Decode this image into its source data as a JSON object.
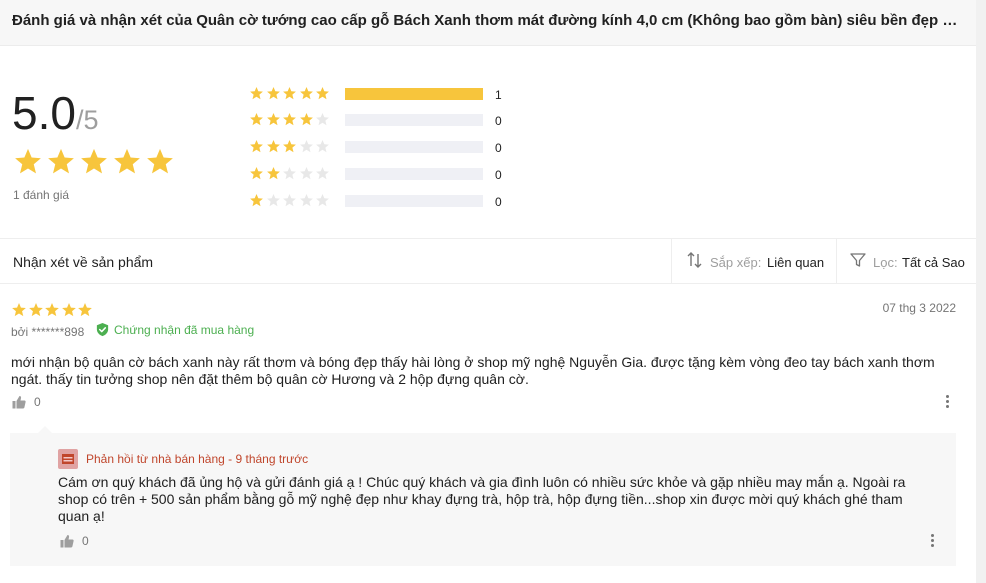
{
  "header": {
    "title": "Đánh giá và nhận xét của Quân cờ tướng cao cấp gỗ Bách Xanh thơm mát đường kính 4,0 cm (Không bao gồm bàn) siêu bền đẹp b..."
  },
  "summary": {
    "score": "5.0",
    "score_max": "/5",
    "star_count": 5,
    "total_label": "1 đánh giá",
    "distribution": [
      {
        "stars": 5,
        "count": "1",
        "fraction": 1.0
      },
      {
        "stars": 4,
        "count": "0",
        "fraction": 0
      },
      {
        "stars": 3,
        "count": "0",
        "fraction": 0
      },
      {
        "stars": 2,
        "count": "0",
        "fraction": 0
      },
      {
        "stars": 1,
        "count": "0",
        "fraction": 0
      }
    ]
  },
  "toolbar": {
    "title": "Nhận xét về sản phẩm",
    "sort_label": "Sắp xếp:",
    "sort_value": "Liên quan",
    "filter_label": "Lọc:",
    "filter_value": "Tất cả Sao"
  },
  "review": {
    "rating": 5,
    "date": "07 thg 3 2022",
    "author": "bởi *******898",
    "verified": "Chứng nhận đã mua hàng",
    "content": "mới nhận bộ quân cờ bách xanh này rất thơm và bóng đẹp thấy hài lòng ở shop mỹ nghệ Nguyễn Gia. được tặng kèm vòng đeo tay bách xanh thơm ngát. thấy tin tưởng shop nên đặt thêm bộ quân cờ Hương và 2 hộp đựng quân cờ.",
    "likes": "0",
    "reply": {
      "header": "Phản hồi từ nhà bán hàng - 9 tháng trước",
      "content": "Cám ơn quý khách đã ủng hộ và gửi đánh giá ạ ! Chúc quý khách và gia đình luôn có nhiều sức khỏe và gặp nhiều may mắn ạ. Ngoài ra shop có trên + 500 sản phẩm bằng gỗ mỹ nghệ đẹp như khay đựng trà, hộp trà, hộp đựng tiền...shop xin được mời quý khách ghé tham quan ạ!",
      "likes": "0"
    }
  },
  "colors": {
    "star_filled": "#f7c53c",
    "star_empty": "#e8e8e8",
    "bar_empty": "#eff0f5",
    "verified": "#4caf50",
    "reply_header": "#c0462c"
  },
  "icons": {
    "star": "star-icon",
    "sort": "sort-icon",
    "filter": "filter-icon",
    "verified": "check-shield-icon",
    "like": "thumbs-up-icon",
    "more": "more-vertical-icon",
    "shop": "shop-icon"
  }
}
